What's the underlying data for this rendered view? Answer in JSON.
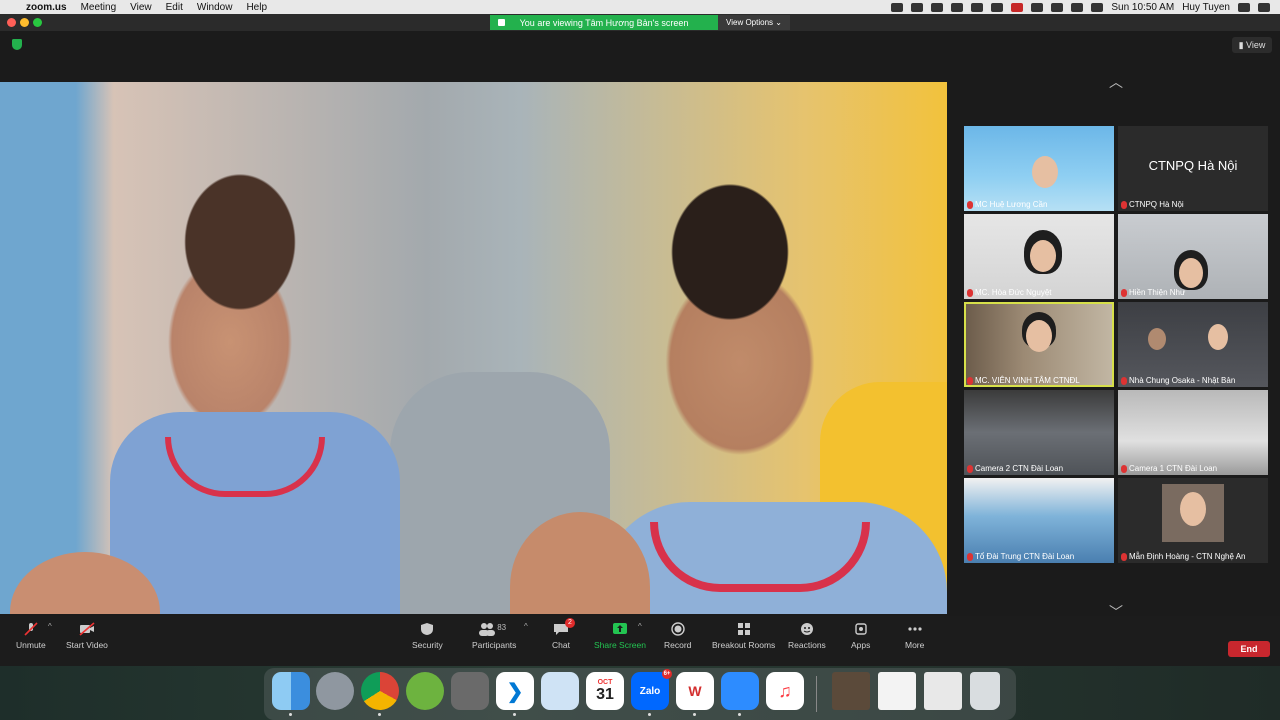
{
  "menubar": {
    "app": "zoom.us",
    "items": [
      "Meeting",
      "View",
      "Edit",
      "Window",
      "Help"
    ],
    "clock": "Sun 10:50 AM",
    "user": "Huy Tuyen"
  },
  "window": {
    "share_banner": "You are viewing Tâm Hương Bản's screen",
    "view_options": "View Options",
    "view_button": "View"
  },
  "gallery": {
    "tiles": [
      {
        "name": "MC Huệ Lương Cần"
      },
      {
        "name": "CTNPQ Hà Nội",
        "big": "CTNPQ Hà Nội"
      },
      {
        "name": "MC. Hòa Đức Nguyệt"
      },
      {
        "name": "Hiền Thiện Như"
      },
      {
        "name": "MC. VIÊN VINH TÂM CTNĐL"
      },
      {
        "name": "Nhà Chung Osaka - Nhật Bản"
      },
      {
        "name": "Camera 2 CTN Đài Loan"
      },
      {
        "name": "Camera 1 CTN Đài Loan"
      },
      {
        "name": "Tổ Đài Trung  CTN Đài Loan"
      },
      {
        "name": "Mẫn Định Hoàng - CTN Nghệ An"
      }
    ]
  },
  "controls": {
    "unmute": "Unmute",
    "start_video": "Start Video",
    "security": "Security",
    "participants": "Participants",
    "participants_count": "83",
    "chat": "Chat",
    "chat_badge": "2",
    "share_screen": "Share Screen",
    "record": "Record",
    "breakout": "Breakout Rooms",
    "reactions": "Reactions",
    "apps": "Apps",
    "more": "More",
    "end": "End"
  },
  "dock": {
    "calendar_month": "OCT",
    "calendar_day": "31",
    "zalo_badge": "6+",
    "zalo": "Zalo"
  },
  "colors": {
    "accent_green": "#23b14d",
    "end_red": "#c8272e",
    "active_speaker": "#d7e04a"
  }
}
